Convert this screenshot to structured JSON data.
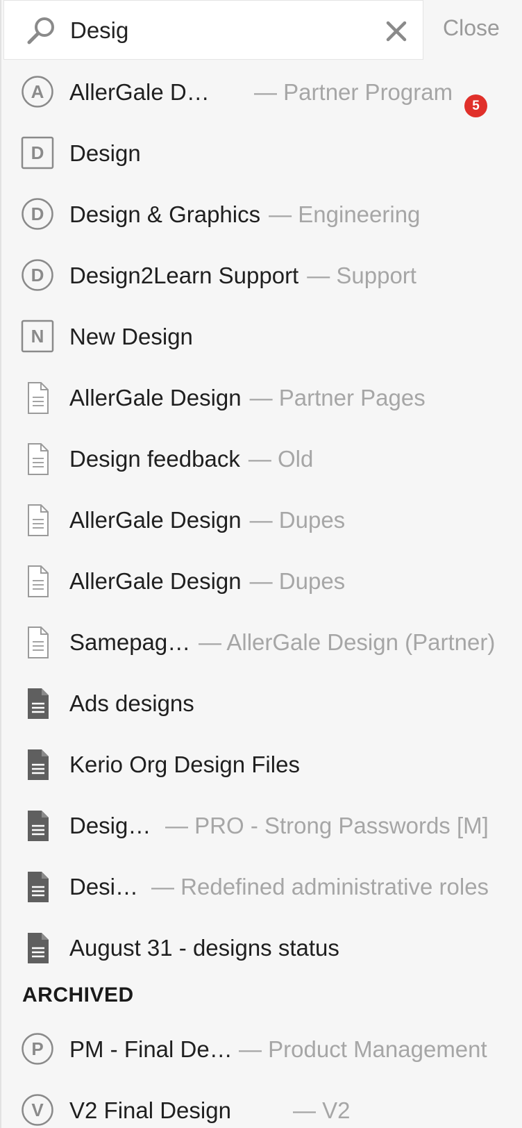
{
  "search": {
    "value": "Desig",
    "close_label": "Close"
  },
  "results": [
    {
      "icon": "space-circle-icon",
      "letter": "A",
      "title": "AllerGale D…",
      "subtitle": "— Partner Program",
      "badge": "5"
    },
    {
      "icon": "space-square-icon",
      "letter": "D",
      "title": "Design",
      "subtitle": ""
    },
    {
      "icon": "space-circle-icon",
      "letter": "D",
      "title": "Design & Graphics",
      "subtitle": "— Engineering"
    },
    {
      "icon": "space-circle-icon",
      "letter": "D",
      "title": "Design2Learn Support",
      "subtitle": "— Support"
    },
    {
      "icon": "space-square-icon",
      "letter": "N",
      "title": "New Design",
      "subtitle": ""
    },
    {
      "icon": "page-outline-icon",
      "title": "AllerGale Design",
      "subtitle": "— Partner Pages"
    },
    {
      "icon": "page-outline-icon",
      "title": "Design feedback",
      "subtitle": "— Old"
    },
    {
      "icon": "page-outline-icon",
      "title": "AllerGale Design",
      "subtitle": "— Dupes"
    },
    {
      "icon": "page-outline-icon",
      "title": "AllerGale Design",
      "subtitle": "— Dupes"
    },
    {
      "icon": "page-outline-icon",
      "title": "Samepag…",
      "subtitle": "— AllerGale Design (Partner)"
    },
    {
      "icon": "document-filled-icon",
      "title": "Ads designs",
      "subtitle": ""
    },
    {
      "icon": "document-filled-icon",
      "title": "Kerio Org Design Files",
      "subtitle": ""
    },
    {
      "icon": "document-filled-icon",
      "title": "Desig…",
      "subtitle": "— PRO - Strong Passwords [M]"
    },
    {
      "icon": "document-filled-icon",
      "title": "Desi…",
      "subtitle": "— Redefined administrative roles"
    },
    {
      "icon": "document-filled-icon",
      "title": "August 31 - designs status",
      "subtitle": ""
    }
  ],
  "archived": {
    "header": "ARCHIVED",
    "items": [
      {
        "icon": "space-circle-icon",
        "letter": "P",
        "title": "PM - Final De…",
        "subtitle": "— Product Management"
      },
      {
        "icon": "space-circle-icon",
        "letter": "V",
        "title": "V2 Final Design",
        "subtitle": "— V2"
      }
    ]
  },
  "colors": {
    "background": "#f6f6f6",
    "title_text": "#1f1f1f",
    "subtitle_text": "#a6a6a6",
    "badge": "#e0302a",
    "icon_gray": "#8a8a8a"
  }
}
